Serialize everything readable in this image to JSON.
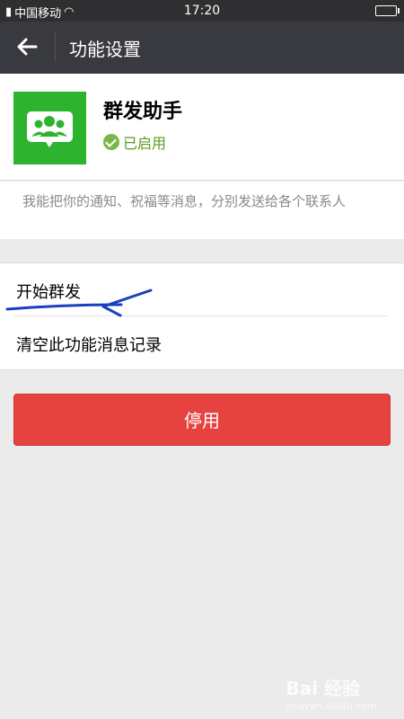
{
  "status_bar": {
    "carrier": "中国移动",
    "time": "17:20"
  },
  "action_bar": {
    "title": "功能设置"
  },
  "plugin": {
    "name": "群发助手",
    "status": "已启用",
    "description": "我能把你的通知、祝福等消息，分别发送给各个联系人"
  },
  "menu": {
    "items": [
      {
        "label": "开始群发"
      },
      {
        "label": "清空此功能消息记录"
      }
    ]
  },
  "disable_button": {
    "label": "停用"
  },
  "watermark": {
    "text": "Bai 经验",
    "url": "jingyan.baidu.com"
  },
  "colors": {
    "accent_green": "#2db32d",
    "status_green": "#5c9c1e",
    "danger_red": "#e64340",
    "action_bar": "#393a3f"
  }
}
